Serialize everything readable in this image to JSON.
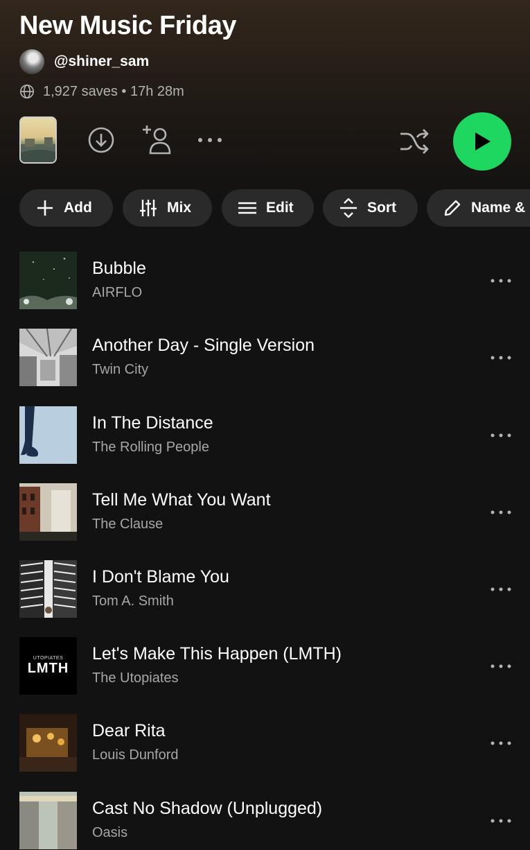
{
  "playlist": {
    "title": "New Music Friday",
    "owner": "@shiner_sam",
    "meta": "1,927 saves • 17h 28m"
  },
  "icons": {
    "globe": "globe-icon",
    "download": "download-icon",
    "add_user": "add-user-icon",
    "more": "more-icon",
    "shuffle": "shuffle-icon",
    "play": "play-icon"
  },
  "colors": {
    "accent": "#1ed760",
    "background": "#121212",
    "chip": "#2a2a2a",
    "secondary_text": "#a7a7a7"
  },
  "chips": [
    {
      "label": "Add",
      "icon": "plus-icon"
    },
    {
      "label": "Mix",
      "icon": "sliders-icon"
    },
    {
      "label": "Edit",
      "icon": "list-icon"
    },
    {
      "label": "Sort",
      "icon": "sort-icon"
    },
    {
      "label": "Name &",
      "icon": "pencil-icon"
    }
  ],
  "tracks": [
    {
      "title": "Bubble",
      "artist": "AIRFLO"
    },
    {
      "title": "Another Day - Single Version",
      "artist": "Twin City"
    },
    {
      "title": "In The Distance",
      "artist": "The Rolling People"
    },
    {
      "title": "Tell Me What You Want",
      "artist": "The Clause"
    },
    {
      "title": "I Don't Blame You",
      "artist": "Tom A. Smith"
    },
    {
      "title": "Let's Make This Happen (LMTH)",
      "artist": "The Utopiates",
      "art_text": "LMTH",
      "art_small_text": "UTOPIATES"
    },
    {
      "title": "Dear Rita",
      "artist": "Louis Dunford"
    },
    {
      "title": "Cast No Shadow (Unplugged)",
      "artist": "Oasis"
    }
  ]
}
